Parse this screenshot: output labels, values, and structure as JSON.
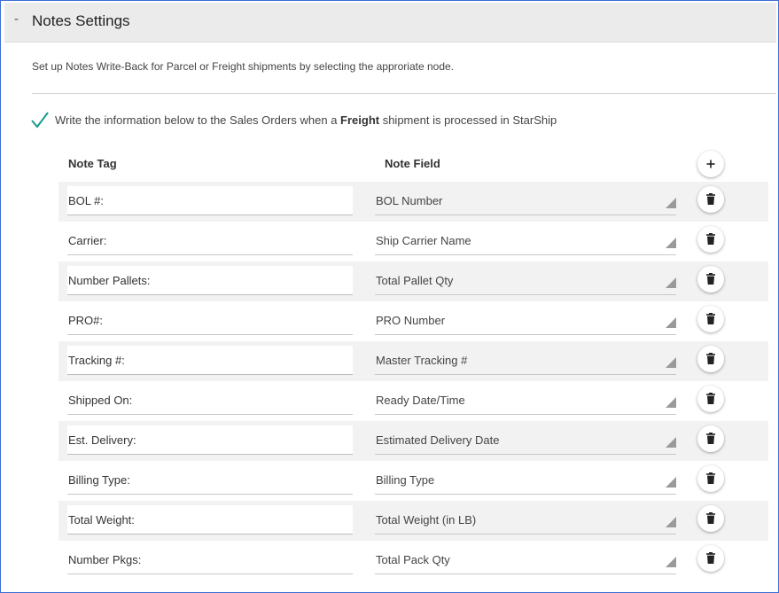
{
  "header": {
    "toggle_symbol": "-",
    "title": "Notes Settings"
  },
  "description": "Set up Notes Write-Back for Parcel or Freight shipments by selecting the approriate node.",
  "write_back": {
    "checked": true,
    "text_before": "Write the information below to the Sales Orders when a ",
    "text_bold": "Freight",
    "text_after": " shipment is processed in StarShip"
  },
  "table": {
    "col_note_tag": "Note Tag",
    "col_note_field": "Note Field",
    "add_icon": "plus-icon",
    "delete_icon": "trash-icon",
    "rows": [
      {
        "tag": "BOL #:",
        "field": "BOL Number"
      },
      {
        "tag": "Carrier:",
        "field": "Ship Carrier Name"
      },
      {
        "tag": "Number Pallets:",
        "field": "Total Pallet Qty"
      },
      {
        "tag": "PRO#:",
        "field": "PRO Number"
      },
      {
        "tag": "Tracking #:",
        "field": "Master Tracking #"
      },
      {
        "tag": "Shipped On:",
        "field": "Ready Date/Time"
      },
      {
        "tag": "Est. Delivery:",
        "field": "Estimated Delivery Date"
      },
      {
        "tag": "Billing Type:",
        "field": "Billing Type"
      },
      {
        "tag": "Total Weight:",
        "field": "Total Weight (in LB)"
      },
      {
        "tag": "Number Pkgs:",
        "field": "Total Pack Qty"
      }
    ]
  },
  "colors": {
    "accent": "#3b6fd4",
    "check": "#1a9a8a",
    "header_bg": "#ebebeb",
    "row_alt": "#f2f2f2"
  }
}
